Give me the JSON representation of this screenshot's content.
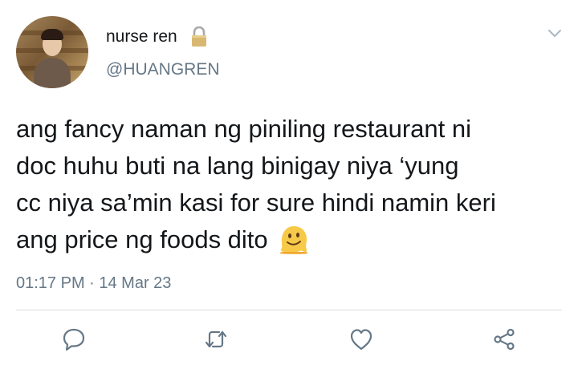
{
  "user": {
    "display_name": "nurse ren",
    "handle": "@HUANGREN",
    "avatar_icon": "profile-photo",
    "protected_icon": "lock-icon"
  },
  "tweet": {
    "text": "ang fancy naman ng piniling restaurant ni\ndoc huhu buti na lang binigay niya ‘yung\ncc niya sa’min kasi for sure hindi namin keri\nang price ng foods dito ",
    "emoji_icon": "melting-face-emoji",
    "timestamp": "01:17 PM · 14 Mar 23"
  },
  "actions": [
    {
      "name": "reply",
      "icon": "comment-icon"
    },
    {
      "name": "retweet",
      "icon": "retweet-icon"
    },
    {
      "name": "like",
      "icon": "heart-icon"
    },
    {
      "name": "share",
      "icon": "share-icon"
    }
  ],
  "colors": {
    "text": "#14171a",
    "secondary": "#657786",
    "icon": "#657786",
    "divider": "#d8dde1",
    "lock": "#c9a86a"
  }
}
